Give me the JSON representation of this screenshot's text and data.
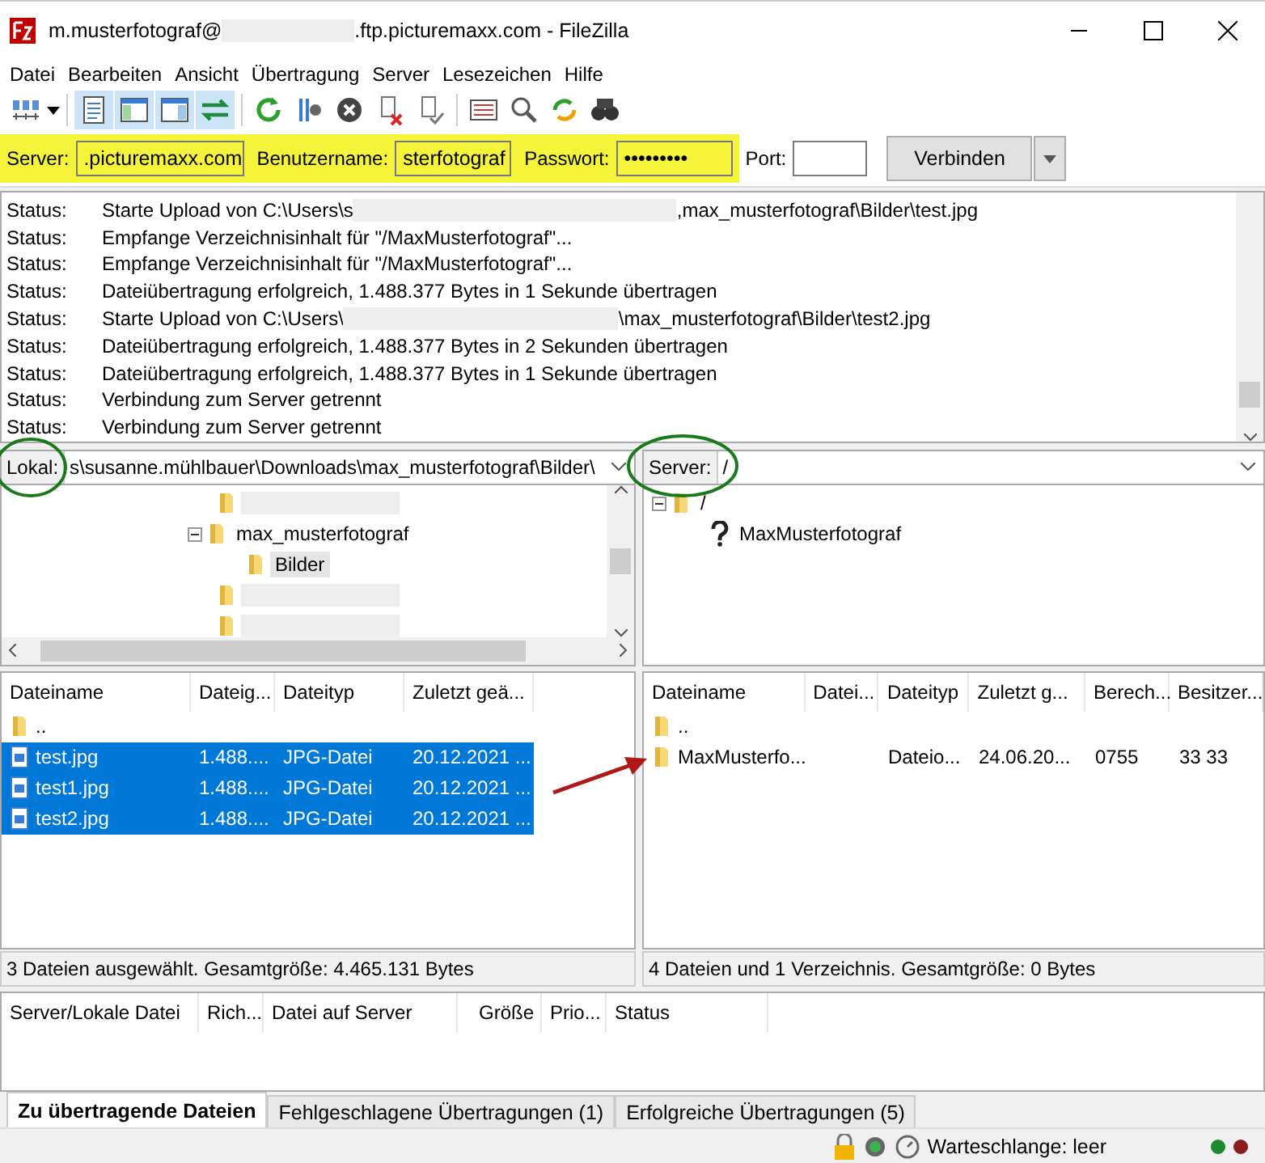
{
  "window": {
    "title_start": "m.musterfotograf@",
    "title_end": ".ftp.picturemaxx.com - FileZilla"
  },
  "menu": [
    "Datei",
    "Bearbeiten",
    "Ansicht",
    "Übertragung",
    "Server",
    "Lesezeichen",
    "Hilfe"
  ],
  "quickconnect": {
    "fields": [
      {
        "label": "Server:",
        "value": ".picturemaxx.com",
        "highlighted": true,
        "kind": "text"
      },
      {
        "label": "Benutzername:",
        "value": "sterfotograf",
        "highlighted": true,
        "kind": "text"
      },
      {
        "label": "Passwort:",
        "value": "•••••••••",
        "highlighted": true,
        "kind": "password"
      },
      {
        "label": "Port:",
        "highlighted": false,
        "kind": "port"
      }
    ],
    "button": "Verbinden"
  },
  "log": [
    {
      "label": "Status:",
      "message": "Starte Upload von C:\\Users\\s",
      "message_end": ",max_musterfotograf\\Bilder\\test.jpg"
    },
    {
      "label": "Status:",
      "message": "Empfange Verzeichnisinhalt für \"/MaxMusterfotograf\"..."
    },
    {
      "label": "Status:",
      "message": "Empfange Verzeichnisinhalt für \"/MaxMusterfotograf\"..."
    },
    {
      "label": "Status:",
      "message": "Dateiübertragung erfolgreich, 1.488.377 Bytes in 1 Sekunde übertragen"
    },
    {
      "label": "Status:",
      "message": "Starte Upload von C:\\Users\\",
      "message_end": "\\max_musterfotograf\\Bilder\\test2.jpg"
    },
    {
      "label": "Status:",
      "message": "Dateiübertragung erfolgreich, 1.488.377 Bytes in 2 Sekunden übertragen"
    },
    {
      "label": "Status:",
      "message": "Dateiübertragung erfolgreich, 1.488.377 Bytes in 1 Sekunde übertragen"
    },
    {
      "label": "Status:",
      "message": "Verbindung zum Server getrennt"
    },
    {
      "label": "Status:",
      "message": "Verbindung zum Server getrennt"
    }
  ],
  "local": {
    "label": "Lokal:",
    "circled": true,
    "path": "s\\susanne.mühlbauer\\Downloads\\max_musterfotograf\\Bilder\\",
    "tree": [
      {
        "kind": "redacted"
      },
      {
        "kind": "folder",
        "label": "max_musterfotograf",
        "expanded": true,
        "selected": false,
        "children": [
          {
            "kind": "folder",
            "label": "Bilder",
            "selected": true
          }
        ]
      },
      {
        "kind": "redacted"
      },
      {
        "kind": "redacted"
      }
    ],
    "columns": [
      "Dateiname",
      "Dateig...",
      "Dateityp",
      "Zuletzt geä..."
    ],
    "rows": [
      {
        "kind": "folder",
        "cells": [
          ".."
        ],
        "selected": false
      },
      {
        "kind": "image",
        "cells": [
          "test.jpg",
          "1.488....",
          "JPG-Datei",
          "20.12.2021 ..."
        ],
        "selected": true
      },
      {
        "kind": "image",
        "cells": [
          "test1.jpg",
          "1.488....",
          "JPG-Datei",
          "20.12.2021 ..."
        ],
        "selected": true
      },
      {
        "kind": "image",
        "cells": [
          "test2.jpg",
          "1.488....",
          "JPG-Datei",
          "20.12.2021 ..."
        ],
        "selected": true
      }
    ],
    "status": "3 Dateien ausgewählt. Gesamtgröße: 4.465.131 Bytes"
  },
  "remote": {
    "label": "Server:",
    "circled": true,
    "path": "/",
    "tree": [
      {
        "kind": "folder",
        "label": "/",
        "expanded": true,
        "selected": false,
        "children": [
          {
            "kind": "unknown",
            "label": "MaxMusterfotograf",
            "selected": false
          }
        ]
      }
    ],
    "columns": [
      "Dateiname",
      "Datei...",
      "Dateityp",
      "Zuletzt g...",
      "Berech...",
      "Besitzer..."
    ],
    "rows": [
      {
        "kind": "folder",
        "cells": [
          ".."
        ],
        "selected": false
      },
      {
        "kind": "folder",
        "cells": [
          "MaxMusterfo...",
          null,
          "Dateio...",
          "24.06.20...",
          "0755",
          "33 33"
        ],
        "selected": false
      }
    ],
    "pointer_arrow": true,
    "status": "4 Dateien und 1 Verzeichnis. Gesamtgröße: 0 Bytes"
  },
  "queue": {
    "columns": [
      "Server/Lokale Datei",
      "Rich...",
      "Datei auf Server",
      "Größe",
      "Prio...",
      "Status"
    ]
  },
  "tabs": [
    {
      "label": "Zu übertragende Dateien",
      "selected": true
    },
    {
      "label": "Fehlgeschlagene Übertragungen (1)",
      "selected": false
    },
    {
      "label": "Erfolgreiche Übertragungen (5)",
      "selected": false
    }
  ],
  "status_bar": {
    "queue": "Warteschlange: leer"
  }
}
